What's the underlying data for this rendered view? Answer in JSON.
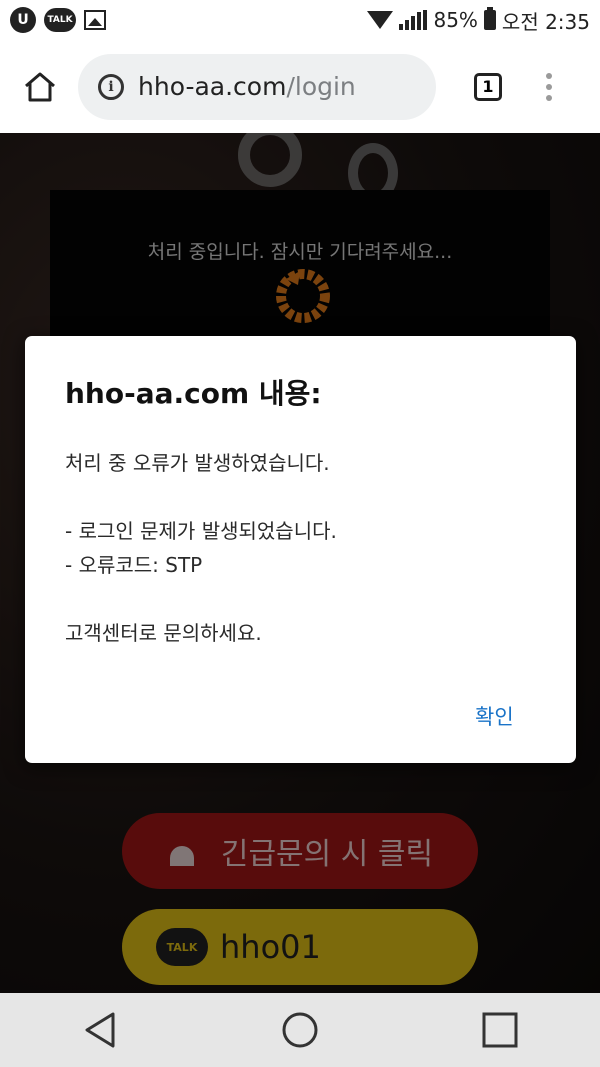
{
  "status_bar": {
    "talk_label": "TALK",
    "battery": "85%",
    "time": "오전 2:35"
  },
  "browser": {
    "url_host": "hho-aa.com",
    "url_path": "/login",
    "tab_count": "1"
  },
  "page": {
    "loading_text": "처리 중입니다. 잠시만 기다려주세요...",
    "emergency_button": "긴급문의 시 클릭",
    "talk_badge": "TALK",
    "talk_id": "hho01"
  },
  "dialog": {
    "title": "hho-aa.com 내용:",
    "lines": [
      "처리 중 오류가 발생하였습니다.",
      "",
      "- 로그인 문제가 발생되었습니다.",
      "- 오류코드: STP",
      "",
      "고객센터로 문의하세요."
    ],
    "ok_label": "확인"
  },
  "colors": {
    "accent_blue": "#1a73c8",
    "emergency_red": "#a11616",
    "talk_yellow": "#e2c117",
    "spinner_orange": "#e07a1a"
  }
}
